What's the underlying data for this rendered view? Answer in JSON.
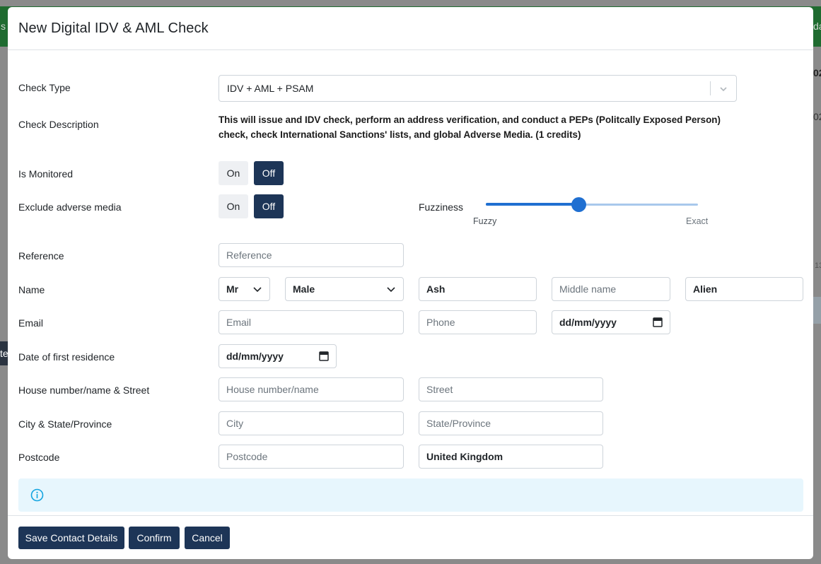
{
  "background": {
    "left_fragment_top": "s",
    "right_fragment_top": "da",
    "right_fragment_2": "02",
    "right_fragment_3": "02",
    "right_fragment_4": "13",
    "left_fragment_mid": "te"
  },
  "modal": {
    "title": "New Digital IDV & AML Check"
  },
  "check_type": {
    "label": "Check Type",
    "value": "IDV + AML + PSAM"
  },
  "check_description": {
    "label": "Check Description",
    "text": "This will issue and IDV check, perform an address verification, and conduct a PEPs (Politcally Exposed Person) check, check International Sanctions' lists, and global Adverse Media. (1 credits)"
  },
  "is_monitored": {
    "label": "Is Monitored",
    "on_label": "On",
    "off_label": "Off",
    "selected": "Off"
  },
  "exclude_adverse_media": {
    "label": "Exclude adverse media",
    "on_label": "On",
    "off_label": "Off",
    "selected": "Off"
  },
  "fuzziness": {
    "label": "Fuzziness",
    "min_label": "Fuzzy",
    "max_label": "Exact",
    "value": 0.44
  },
  "reference": {
    "label": "Reference",
    "placeholder": "Reference"
  },
  "name": {
    "label": "Name",
    "title_value": "Mr",
    "gender_value": "Male",
    "first_name": "Ash",
    "middle_placeholder": "Middle name",
    "last_name": "Alien"
  },
  "email": {
    "label": "Email",
    "email_placeholder": "Email",
    "phone_placeholder": "Phone",
    "dob_placeholder": "dd/mm/yyyy"
  },
  "first_residence": {
    "label": "Date of first residence",
    "placeholder": "dd/mm/yyyy"
  },
  "street": {
    "label": "House number/name & Street",
    "house_placeholder": "House number/name",
    "street_placeholder": "Street"
  },
  "city": {
    "label": "City & State/Province",
    "city_placeholder": "City",
    "state_placeholder": "State/Province"
  },
  "postcode": {
    "label": "Postcode",
    "postcode_placeholder": "Postcode",
    "country_value": "United Kingdom"
  },
  "footer": {
    "save_label": "Save Contact Details",
    "confirm_label": "Confirm",
    "cancel_label": "Cancel"
  },
  "colors": {
    "primary": "#1d3557",
    "slider": "#1f6fd1",
    "alert_bg": "#e7f6fd",
    "info_icon": "#12a4e0"
  }
}
